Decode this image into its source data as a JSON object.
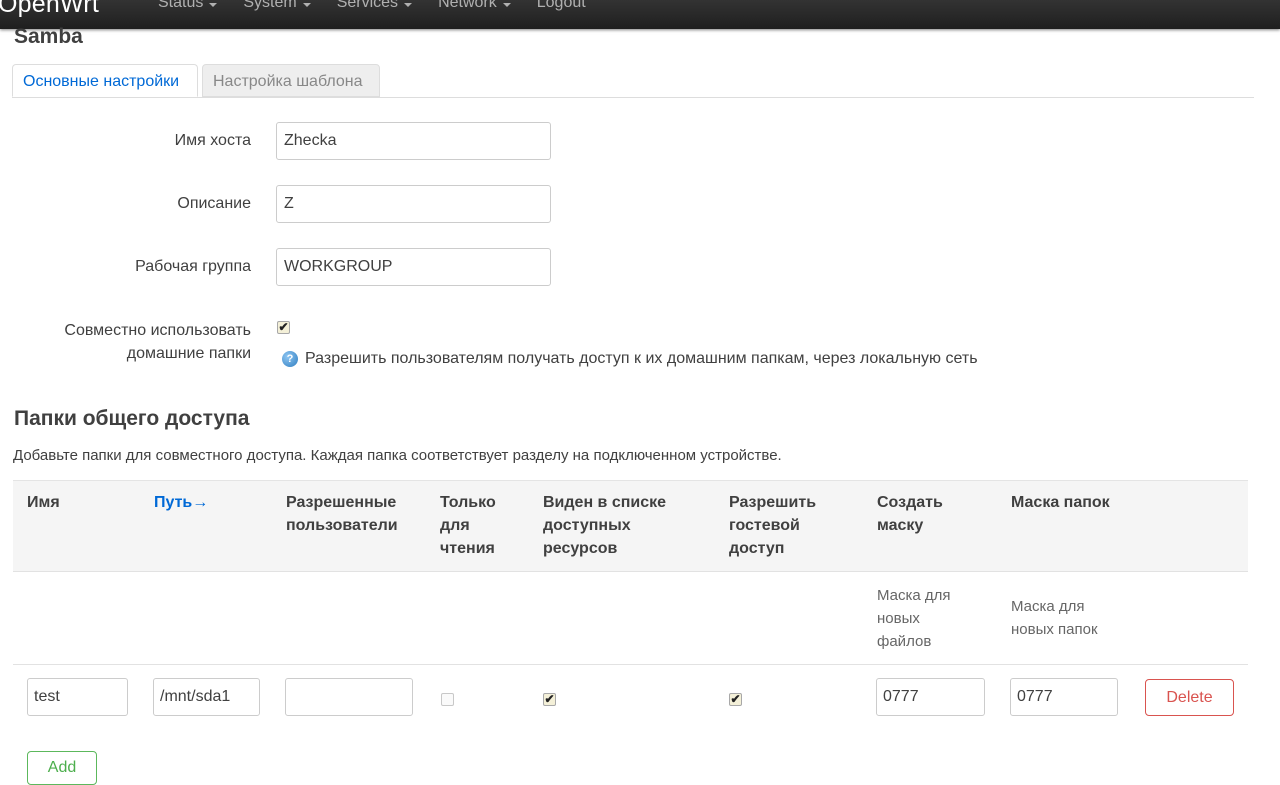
{
  "navbar": {
    "brand": "OpenWrt",
    "menu": [
      {
        "label": "Status"
      },
      {
        "label": "System"
      },
      {
        "label": "Services"
      },
      {
        "label": "Network"
      },
      {
        "label": "Logout"
      }
    ]
  },
  "page": {
    "title": "Samba"
  },
  "tabs": [
    {
      "label": "Основные настройки",
      "active": true
    },
    {
      "label": "Настройка шаблона",
      "active": false
    }
  ],
  "form": {
    "hostname": {
      "label": "Имя хоста",
      "value": "Zhecka"
    },
    "description": {
      "label": "Описание",
      "value": "Z"
    },
    "workgroup": {
      "label": "Рабочая группа",
      "value": "WORKGROUP"
    },
    "homes": {
      "label_line1": "Совместно использовать",
      "label_line2": "домашние папки",
      "checked": true,
      "hint": "Разрешить пользователям получать доступ к их домашним папкам, через локальную сеть"
    }
  },
  "shares": {
    "title": "Папки общего доступа",
    "description": "Добавьте папки для совместного доступа. Каждая папка соответствует разделу на подключенном устройстве.",
    "columns": {
      "name": "Имя",
      "path": "Путь→",
      "users_1": "Разрешенные",
      "users_2": "пользователи",
      "ro_1": "Только",
      "ro_2": "для",
      "ro_3": "чтения",
      "browse_1": "Виден в списке",
      "browse_2": "доступных",
      "browse_3": "ресурсов",
      "guest_1": "Разрешить",
      "guest_2": "гостевой",
      "guest_3": "доступ",
      "cmask_1": "Создать",
      "cmask_2": "маску",
      "dmask": "Маска папок"
    },
    "subheaders": {
      "cmask_1": "Маска для",
      "cmask_2": "новых",
      "cmask_3": "файлов",
      "dmask_1": "Маска для",
      "dmask_2": "новых папок"
    },
    "rows": [
      {
        "name": "test",
        "path": "/mnt/sda1",
        "users": "",
        "read_only": false,
        "browseable": true,
        "guest_ok": true,
        "create_mask": "0777",
        "dir_mask": "0777",
        "delete_label": "Delete"
      }
    ],
    "add_label": "Add"
  },
  "colors": {
    "accent": "#0069d6",
    "danger": "#d9534f",
    "success": "#5cb85c"
  }
}
